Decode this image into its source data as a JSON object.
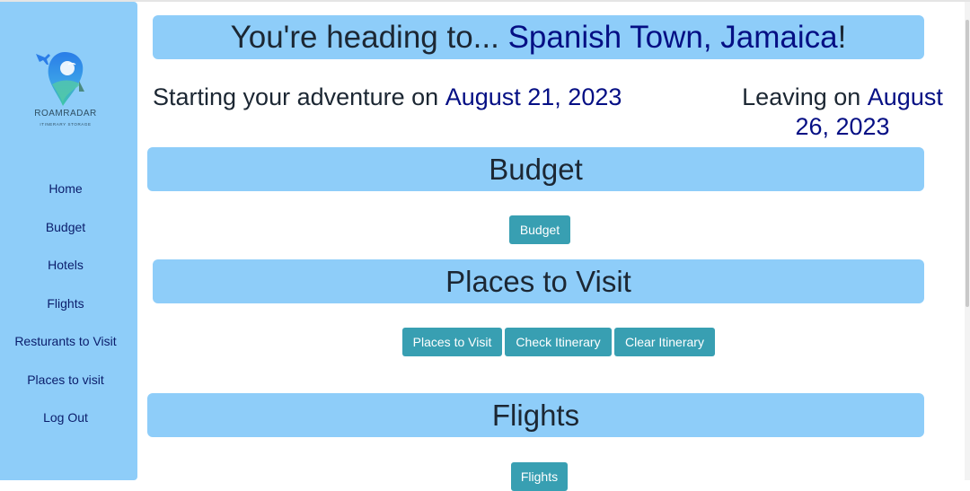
{
  "sidebar": {
    "brand": "ROAMRADAR",
    "tagline": "ITINERARY STORAGE",
    "items": [
      {
        "label": "Home"
      },
      {
        "label": "Budget"
      },
      {
        "label": "Hotels"
      },
      {
        "label": "Flights"
      },
      {
        "label": "Resturants to Visit"
      },
      {
        "label": "Places to visit"
      },
      {
        "label": "Log Out"
      }
    ]
  },
  "header": {
    "prefix": "You're heading to... ",
    "destination": "Spanish Town, Jamaica",
    "suffix": "!"
  },
  "dates": {
    "start_prefix": "Starting your adventure on ",
    "start_date": "August 21, 2023",
    "leave_prefix": "Leaving on ",
    "leave_date_line1": "August",
    "leave_date_line2": "26, 2023"
  },
  "sections": {
    "budget": {
      "title": "Budget",
      "button": "Budget"
    },
    "places": {
      "title": "Places to Visit",
      "buttons": [
        "Places to Visit",
        "Check Itinerary",
        "Clear Itinerary"
      ]
    },
    "flights": {
      "title": "Flights",
      "button": "Flights"
    }
  },
  "colors": {
    "panel": "#8ecdf9",
    "highlight": "#050f84",
    "button": "#389fb2"
  }
}
